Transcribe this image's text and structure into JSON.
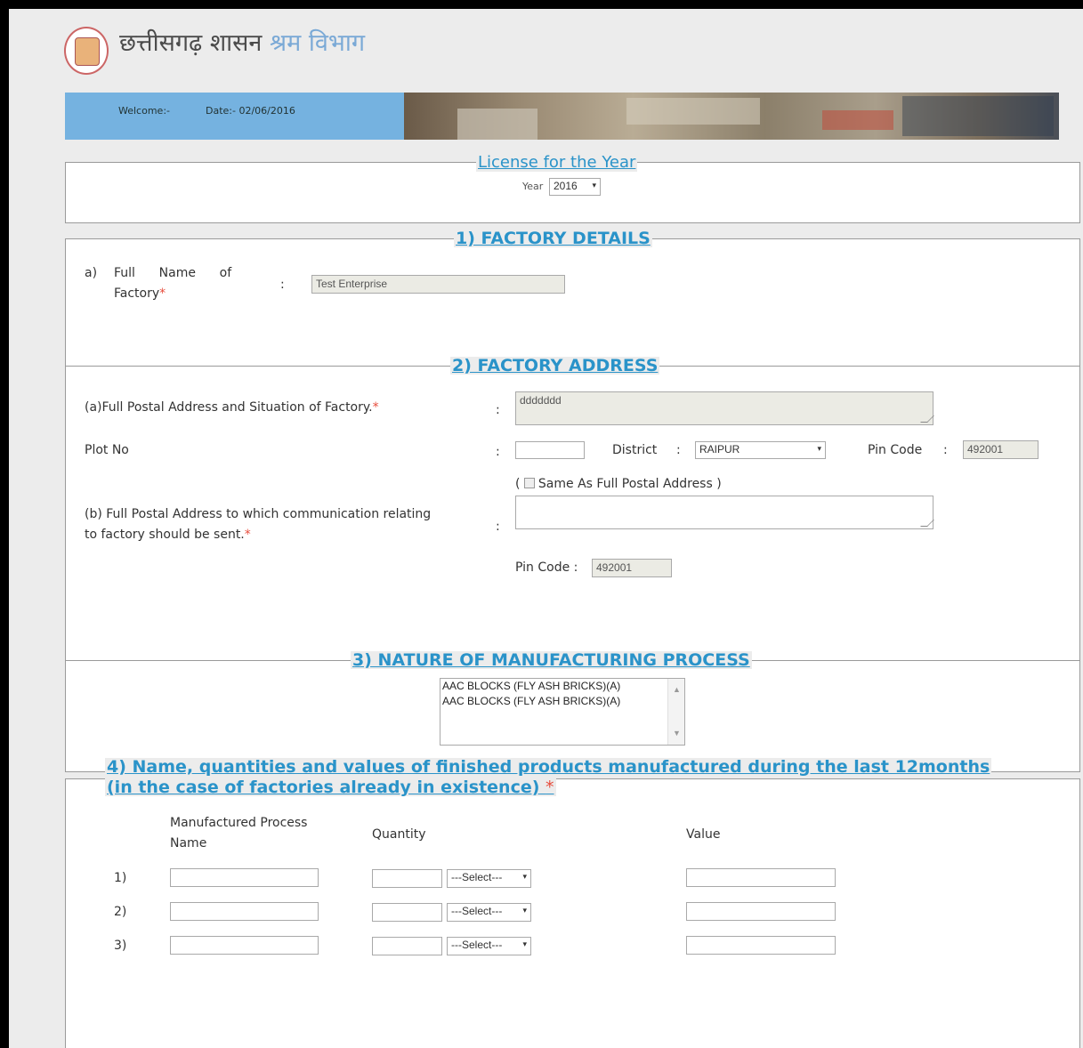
{
  "header": {
    "title_main": "छत्तीसगढ़ शासन",
    "title_dept": "श्रम विभाग"
  },
  "banner": {
    "welcome": "Welcome:-",
    "date": "Date:- 02/06/2016"
  },
  "license": {
    "legend": "License for the Year",
    "year_label": "Year",
    "year_value": "2016"
  },
  "factory_details": {
    "legend": "1) FACTORY DETAILS",
    "index": "a)",
    "name_label_line1": "Full      Name      of",
    "name_label_line2": "Factory",
    "colon": ":",
    "name_value": "Test Enterprise"
  },
  "factory_address": {
    "legend": "2) FACTORY ADDRESS",
    "full_postal_label": "(a)Full Postal Address and Situation of Factory.",
    "full_postal_value": "ddddddd",
    "plot_label": "Plot No",
    "plot_value": "",
    "district_label": "District",
    "district_value": "RAIPUR",
    "pincode_label": "Pin Code",
    "pincode_value": "492001",
    "same_as_text": "Same As Full Postal Address",
    "comm_label_line1": "(b) Full Postal Address to which communication relating",
    "comm_label_line2": "to factory should be sent.",
    "comm_value": "",
    "comm_pincode_label": "Pin Code :",
    "comm_pincode_value": "492001"
  },
  "manufacturing": {
    "legend": "3) NATURE OF MANUFACTURING PROCESS",
    "options": [
      "AAC BLOCKS (FLY ASH BRICKS)(A)",
      "AAC BLOCKS (FLY ASH BRICKS)(A)"
    ]
  },
  "products": {
    "legend_line1": "4) Name, quantities and values of finished products manufactured during the last 12months",
    "legend_line2": "(in the case of factories already in existence)",
    "col_name_line1": "Manufactured Process",
    "col_name_line2": "Name",
    "col_quantity": "Quantity",
    "col_value": "Value",
    "select_placeholder": "---Select---",
    "rows": [
      {
        "index": "1)"
      },
      {
        "index": "2)"
      },
      {
        "index": "3)"
      }
    ]
  },
  "required_mark": "*"
}
